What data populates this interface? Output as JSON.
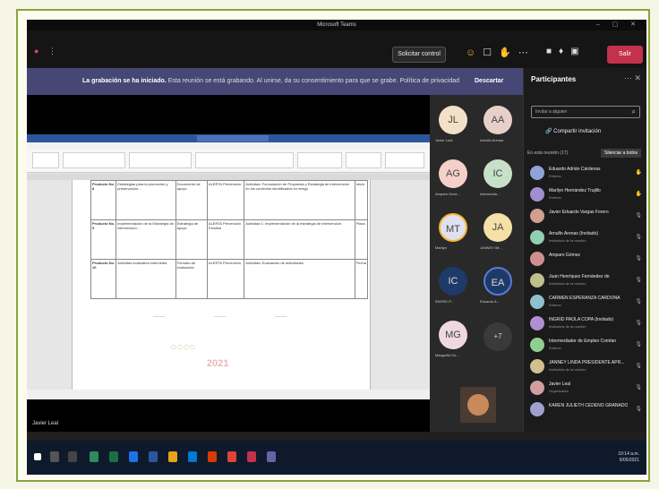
{
  "window": {
    "title": "Microsoft Teams"
  },
  "toolbar": {
    "share_label": "Solicitar control",
    "leave_label": "Salir"
  },
  "banner": {
    "bold": "La grabación se ha iniciado.",
    "text": "Esta reunión se está grabando. Al unirse, da su consentimiento para que se grabe. Política de privacidad",
    "button": "Descartar"
  },
  "document": {
    "table": [
      [
        "Producto No. 8",
        "Estrategias para la promoción y preservación...",
        "Documento de apoyo",
        "ALERTA Prevención",
        "Actividad: Formulación de Propuesta y Estrategia de intervención en los contextos identificados en riesgo",
        "Inicio"
      ],
      [
        "Producto No. 9",
        "Implementación de la Estrategia de intervención...",
        "Estrategia de apoyo",
        "ALERTA Prevención Familiar",
        "Actividad 1: Implementación de la estrategia de intervención",
        "Plazo"
      ],
      [
        "Producto No. 10",
        "Actividad evaluativa intermedia",
        "Formato de evaluación",
        "ALERTA Prevención",
        "Actividad: Evaluación de actividades",
        "Fecha"
      ]
    ],
    "year": "2021",
    "speaker": "Javier Leal"
  },
  "tiles": [
    {
      "initials": "JL",
      "name": "Javier Leal",
      "color": "#f2e0c8"
    },
    {
      "initials": "AA",
      "name": "Arnulfo Arenas",
      "color": "#e8d0c8"
    },
    {
      "initials": "AG",
      "name": "Amparo Gonz...",
      "color": "#f5d0c8"
    },
    {
      "initials": "IC",
      "name": "Intermedia...",
      "color": "#c8e0c8"
    },
    {
      "initials": "MT",
      "name": "Marilyn",
      "color": "#e0e0f0"
    },
    {
      "initials": "JA",
      "name": "JANNEY IM...",
      "color": "#f5e0a8"
    },
    {
      "initials": "IC",
      "name": "INGRID P...",
      "color": "#1e3a68"
    },
    {
      "initials": "EA",
      "name": "Eduardo A...",
      "color": "#1e3a68"
    },
    {
      "initials": "MG",
      "name": "Margarita Gó...",
      "color": "#f0d8e0"
    }
  ],
  "tiles_more": "+7",
  "panel": {
    "title": "Participantes",
    "search_placeholder": "Invitar a alguien",
    "invite": "Compartir invitación",
    "section": "En esta reunión (17)",
    "mute_all": "Silenciar a todos",
    "participants": [
      {
        "name": "Eduardo Adrián Cárdenas",
        "role": "Externo",
        "color": "#8fa3d8",
        "icon": "hand"
      },
      {
        "name": "Marilyn Hernández Trujillo",
        "role": "Externo",
        "color": "#a08fd0",
        "icon": "hand"
      },
      {
        "name": "Javier Eduardo Vargas Forero",
        "role": "",
        "color": "#d0a08f",
        "icon": "mic"
      },
      {
        "name": "Arnulfo Arenas (Invitado)",
        "role": "Invitado/a de la reunión",
        "color": "#8fd0b0",
        "icon": "mic"
      },
      {
        "name": "Amparo Gómez",
        "role": "",
        "color": "#d08f8f",
        "icon": "mic"
      },
      {
        "name": "Juan Henríquez Fernández de",
        "role": "Invitado/a de la reunión",
        "color": "#c0c08f",
        "icon": "mic"
      },
      {
        "name": "CARMEN ESPERANZA CARDONA",
        "role": "Externo",
        "color": "#8fc0d0",
        "icon": "mic"
      },
      {
        "name": "INGRID PAOLA COPA (Invitado)",
        "role": "Invitado/a de la reunión",
        "color": "#b08fd0",
        "icon": "mic"
      },
      {
        "name": "Intermediador de Empleo Comfan",
        "role": "Externo",
        "color": "#8fd08f",
        "icon": "mic"
      },
      {
        "name": "JANNEY LINDA PRESIDENTE APR...",
        "role": "Invitado/a de la reunión",
        "color": "#d0c08f",
        "icon": "mic"
      },
      {
        "name": "Javier Leal",
        "role": "Organizador",
        "color": "#d0a0a0",
        "icon": "mic"
      },
      {
        "name": "KAREN JULIETH CEDEÑO GRANADOS",
        "role": "",
        "color": "#a0a0d0",
        "icon": "mic"
      }
    ]
  },
  "clock": {
    "time": "10:14 a.m.",
    "date": "6/05/2021"
  }
}
